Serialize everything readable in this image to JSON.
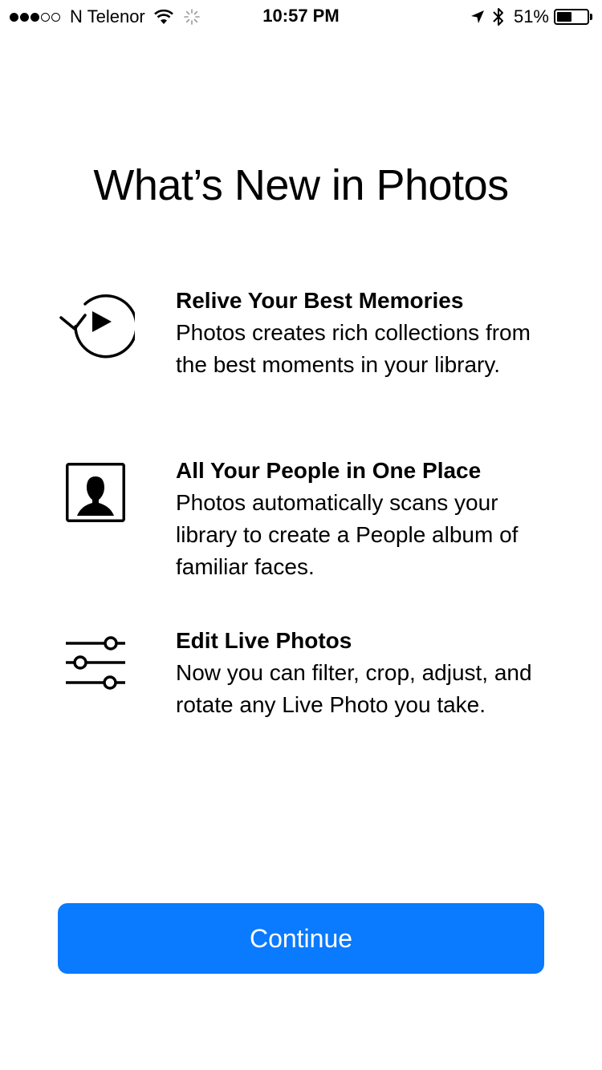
{
  "status_bar": {
    "carrier": "N Telenor",
    "signal_bars_filled": 3,
    "signal_bars_total": 5,
    "time": "10:57 PM",
    "battery_percent_label": "51%",
    "battery_level": 0.51
  },
  "title": "What’s New in Photos",
  "features": [
    {
      "icon": "memories-replay-icon",
      "title": "Relive Your Best Memories",
      "description": "Photos creates rich collections from the best moments in your library."
    },
    {
      "icon": "people-portrait-icon",
      "title": "All Your People in One Place",
      "description": "Photos automatically scans your library to create a People album of familiar faces."
    },
    {
      "icon": "sliders-adjust-icon",
      "title": "Edit Live Photos",
      "description": "Now you can filter, crop, adjust, and rotate any Live Photo you take."
    }
  ],
  "continue_button": {
    "label": "Continue",
    "color": "#0a7aff"
  }
}
